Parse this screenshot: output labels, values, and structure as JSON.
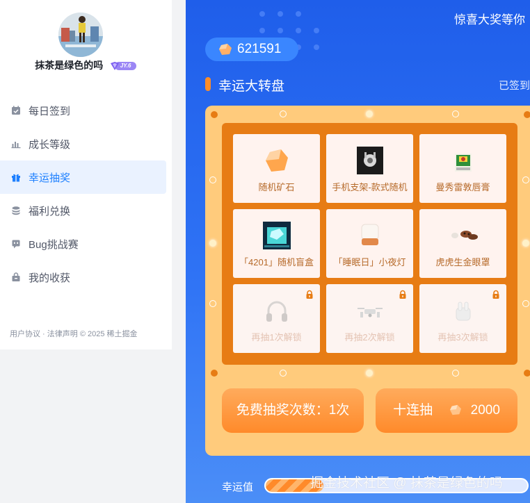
{
  "user": {
    "name": "抹茶是绿色的吗",
    "level": "JY.6"
  },
  "sidebar": {
    "items": [
      {
        "label": "每日签到",
        "icon": "calendar-check-icon",
        "active": false
      },
      {
        "label": "成长等级",
        "icon": "bar-chart-icon",
        "active": false
      },
      {
        "label": "幸运抽奖",
        "icon": "gift-icon",
        "active": true
      },
      {
        "label": "福利兑换",
        "icon": "coin-stack-icon",
        "active": false
      },
      {
        "label": "Bug挑战赛",
        "icon": "bug-icon",
        "active": false
      },
      {
        "label": "我的收获",
        "icon": "bag-icon",
        "active": false
      }
    ],
    "footer": "用户协议 · 法律声明 © 2025 稀土掘金"
  },
  "main": {
    "marquee": "惊喜大奖等你",
    "ore_count": "621591",
    "section_title": "幸运大转盘",
    "signed_text": "已签到",
    "prizes": [
      {
        "label": "随机矿石",
        "icon": "ore-icon",
        "locked": false
      },
      {
        "label": "手机支架-款式随机",
        "icon": "phone-stand-icon",
        "locked": false
      },
      {
        "label": "曼秀雷敦唇膏",
        "icon": "lip-balm-icon",
        "locked": false
      },
      {
        "label": "「4201」随机盲盒",
        "icon": "blind-box-icon",
        "locked": false
      },
      {
        "label": "「睡眠日」小夜灯",
        "icon": "night-lamp-icon",
        "locked": false
      },
      {
        "label": "虎虎生金眼罩",
        "icon": "eye-mask-icon",
        "locked": false
      },
      {
        "label": "再抽1次解锁",
        "icon": "headphones-icon",
        "locked": true
      },
      {
        "label": "再抽2次解锁",
        "icon": "drone-icon",
        "locked": true
      },
      {
        "label": "再抽3次解锁",
        "icon": "earbuds-icon",
        "locked": true
      }
    ],
    "free_draw_label": "免费抽奖次数：1次",
    "ten_draw_label": "十连抽",
    "ten_draw_cost": "2000",
    "luck_label": "幸运值",
    "luck_progress": 0.22
  },
  "watermark": "掘金技术社区 @ 抹茶是绿色的吗",
  "colors": {
    "accent": "#1e80ff",
    "board": "#ffcb7c",
    "frame": "#e77c14",
    "button": "#ff8a2a"
  }
}
